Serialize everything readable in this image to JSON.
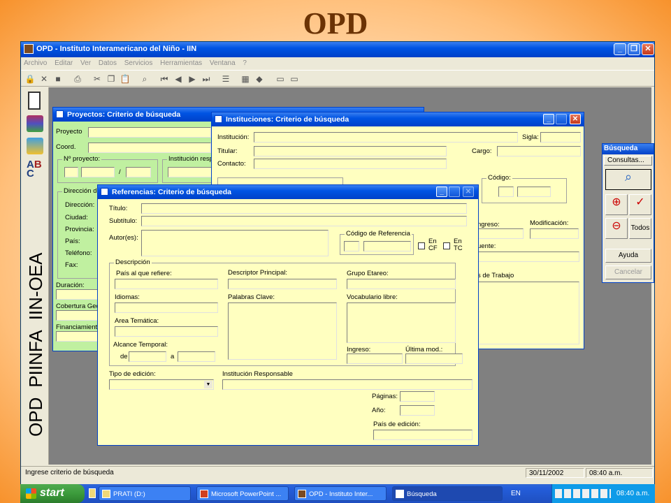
{
  "slide_title": "OPD",
  "app": {
    "title": "OPD - Instituto Interamericano del Niño - IIN",
    "menu": [
      "Archivo",
      "Editar",
      "Ver",
      "Datos",
      "Servicios",
      "Herramientas",
      "Ventana",
      "?"
    ],
    "min_glyph": "_",
    "max_glyph": "❐",
    "close_glyph": "✕"
  },
  "sidebar_vertical": {
    "opd": "OPD",
    "piinfa": "PIINFA",
    "iin_oea": "IIN-OEA"
  },
  "proyectos": {
    "title": "Proyectos: Criterio de búsqueda",
    "proyecto": "Proyecto",
    "coord": "Coord.",
    "nro_proyecto": "Nº proyecto:",
    "slash": "/",
    "institucion_resp": "Institución respo",
    "direccion_group": "Dirección de",
    "direccion": "Dirección:",
    "ciudad": "Ciudad:",
    "provincia": "Provincia:",
    "pais": "País:",
    "telefono": "Teléfono:",
    "fax": "Fax:",
    "duracion": "Duración:",
    "cobertura": "Cobertura Geo",
    "financiamiento": "Financiamiento"
  },
  "instituciones": {
    "title": "Instituciones: Criterio de búsqueda",
    "institucion": "Institución:",
    "sigla": "Sigla:",
    "titular": "Titular:",
    "cargo": "Cargo:",
    "contacto": "Contacto:",
    "codigo": "Código:",
    "ingreso": "ngreso:",
    "modificacion": "Modificación:",
    "fuente": "uente:",
    "areas_trabajo": "s de Trabajo"
  },
  "referencias": {
    "title": "Referencias: Criterio de búsqueda",
    "titulo": "Título:",
    "subtitulo": "Subtítulo:",
    "autores": "Autor(es):",
    "codigo_ref": "Código de Referencia",
    "en_cf_1": "En",
    "en_cf_2": "CF",
    "en_tc_1": "En",
    "en_tc_2": "TC",
    "descripcion": "Descripción",
    "pais_refiere": "País al que refiere:",
    "descriptor": "Descriptor Principal:",
    "grupo_etareo": "Grupo Etareo:",
    "idiomas": "Idiomas:",
    "palabras_clave": "Palabras Clave:",
    "vocabulario": "Vocabulario libre:",
    "area_tematica": "Area Temática:",
    "alcance_temporal": "Alcance Temporal:",
    "de": "de",
    "a": "a",
    "ingreso": "Ingreso:",
    "ultima_mod": "Última mod.:",
    "tipo_edicion": "Tipo de edición:",
    "institucion_resp": "Institución Responsable",
    "paginas": "Páginas:",
    "anio": "Año:",
    "pais_edicion": "País de edición:",
    "combo_arrow": "▼"
  },
  "busqueda": {
    "title": "Búsqueda",
    "consultas": "Consultas...",
    "todos": "Todos",
    "ayuda": "Ayuda",
    "cancelar": "Cancelar"
  },
  "status": {
    "message": "Ingrese criterio de búsqueda",
    "date": "30/11/2002",
    "time": "08:40 a.m."
  },
  "taskbar": {
    "start": "start",
    "tasks": [
      "PRATI (D:)",
      "Microsoft PowerPoint ...",
      "OPD - Instituto Inter...",
      "Búsqueda"
    ],
    "lang": "EN",
    "clock": "08:40 a.m."
  },
  "colors": {
    "dialog_yellow": "#ffffc0",
    "dialog_green": "#c0f0a0",
    "xp_blue": "#0054e3"
  }
}
